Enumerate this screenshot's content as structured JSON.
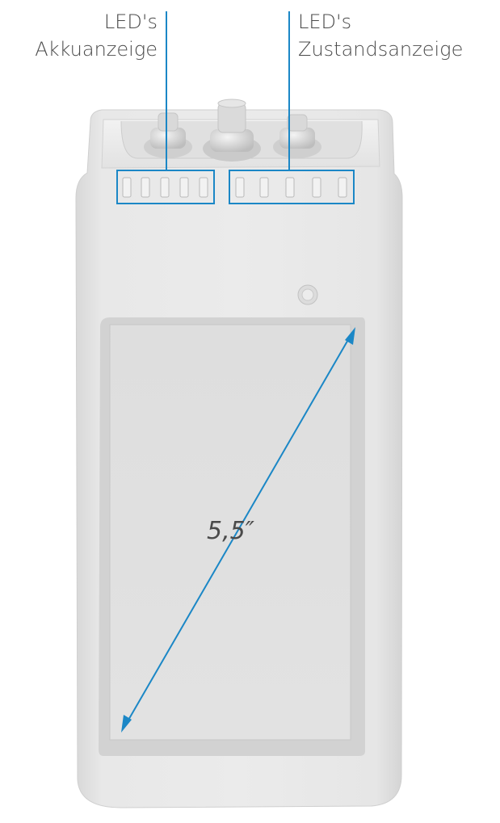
{
  "labels": {
    "battery_leds": {
      "line1": "LED's",
      "line2": "Akkuanzeige"
    },
    "status_leds": {
      "line1": "LED's",
      "line2": "Zustandsanzeige"
    },
    "screen_diagonal": "5,5″"
  },
  "colors": {
    "accent": "#1b87c6",
    "body": "#e4e4e4",
    "text": "#4a4a4a"
  },
  "leds": {
    "battery_count": 5,
    "status_count": 5
  }
}
